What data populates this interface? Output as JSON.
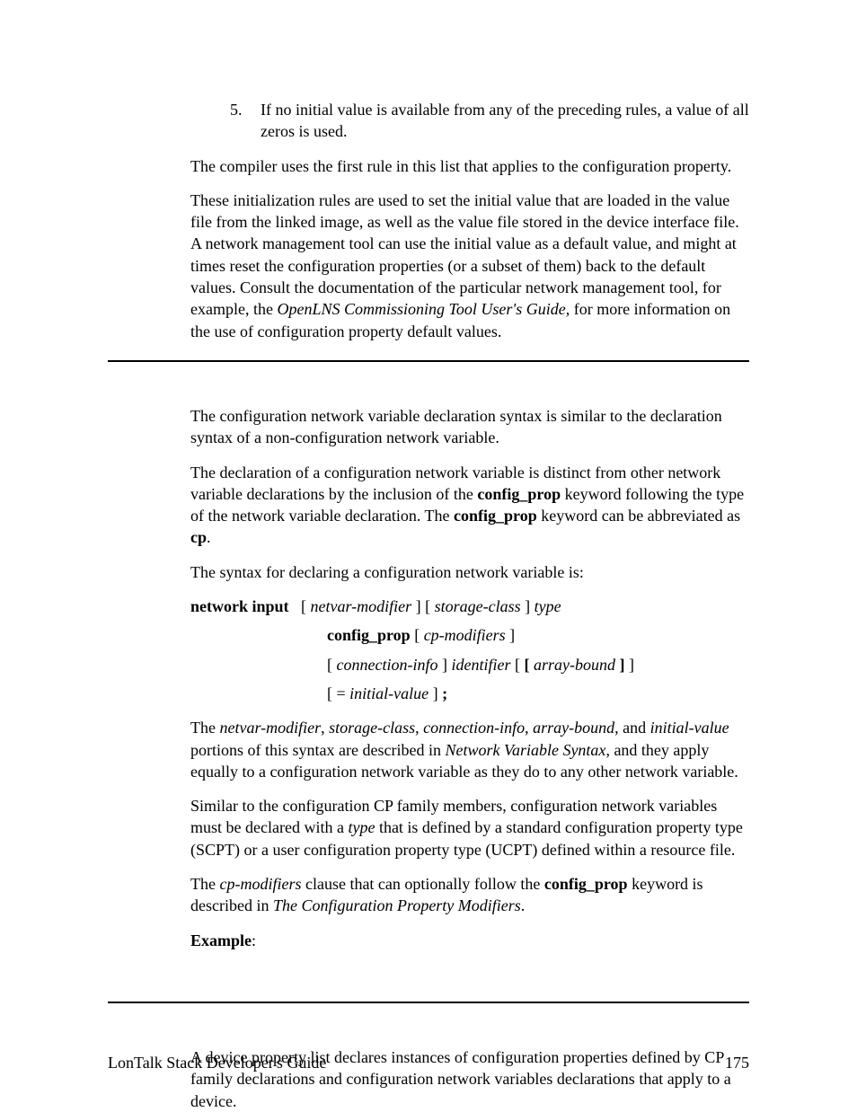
{
  "list": {
    "num": "5.",
    "text": "If no initial value is available from any of the preceding rules, a value of all zeros is used."
  },
  "p_compiler": "The compiler uses the first rule in this list that applies to the configuration property.",
  "p_init_1": "These initialization rules are used to set the initial value that are loaded in the value file from the linked image, as well as the value file stored in the device interface file.  A network management tool can use the initial value as a default value, and might at times reset the configuration properties (or a subset of them) back to the default values.  Consult the documentation of the particular network management tool, for example, the ",
  "p_init_em": "OpenLNS Commissioning Tool User's Guide",
  "p_init_2": ", for more information on the use of configuration property default values.",
  "p_cnv_1": "The configuration network variable declaration syntax is similar to the declaration syntax of a non-configuration network variable.",
  "p_cnv_2a": "The declaration of a configuration network variable is distinct from other network variable declarations by the inclusion of the ",
  "kw_config_prop": "config_prop",
  "p_cnv_2b": " keyword following the type of the network variable declaration.  The ",
  "p_cnv_2c": " keyword can be abbreviated as ",
  "kw_cp": "cp",
  "p_syntax_intro": "The syntax for declaring a configuration network variable is:",
  "syn": {
    "network_input": "network input",
    "lb": "[",
    "rb": "]",
    "netvar_mod": "netvar-modifier",
    "storage_class": "storage-class",
    "type": "type",
    "config_prop": "config_prop",
    "cp_modifiers": "cp-modifiers",
    "connection_info": "connection-info",
    "identifier": "identifier",
    "bold_lb": "[",
    "array_bound": "array-bound",
    "bold_rb": "]",
    "eq": "=",
    "initial_value": "initial-value",
    "semi": ";"
  },
  "p_desc_1a": "The ",
  "p_desc_nv": "netvar-modifier",
  "p_desc_comma": ", ",
  "p_desc_sc": "storage-class",
  "p_desc_ci": "connection-info",
  "p_desc_ab": "array-bound",
  "p_desc_and": ", and ",
  "p_desc_iv": "initial-value",
  "p_desc_1b": " portions of this syntax are described in ",
  "p_desc_nvs": "Network Variable Syntax",
  "p_desc_1c": ", and they apply equally to a configuration network variable as they do to any other network variable.",
  "p_similar_a": "Similar to the configuration CP family members, configuration network variables must be declared with a ",
  "p_similar_type": "type",
  "p_similar_b": " that is defined by a standard configuration property type (SCPT) or a user configuration property type (UCPT) defined within a resource file.",
  "p_cpmod_a": "The ",
  "p_cpmod_em": "cp-modifiers",
  "p_cpmod_b": " clause that can optionally follow the ",
  "p_cpmod_c": " keyword is described in ",
  "p_cpmod_ref": "The Configuration Property Modifiers",
  "p_cpmod_d": ".",
  "example_label": "Example",
  "example_colon": ":",
  "p_device": "A device property list declares instances of configuration properties defined by CP family declarations and configuration network variables declarations that apply to a device.",
  "footer_left": "LonTalk Stack Developer's Guide",
  "footer_right": "175"
}
